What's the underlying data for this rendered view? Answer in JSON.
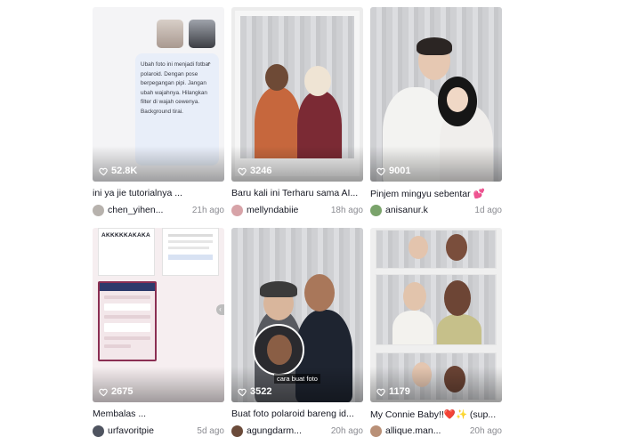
{
  "cards": [
    {
      "likes": "52.8K",
      "title": "ini ya jie tutorialnya ...",
      "user": "chen_yihen...",
      "time": "21h ago",
      "bubble_text": "Ubah foto ini menjadi fotbar polaroid. Dengan pose berpegangan pipi. Jangan ubah wajahnya. Hilangkan filter di wajah cewenya. Background tirai.",
      "icon": "chevron-up-icon"
    },
    {
      "likes": "3246",
      "title": "Baru kali ini Terharu sama AI...",
      "user": "mellyndabiie",
      "time": "18h ago"
    },
    {
      "likes": "9001",
      "title": "Pinjem mingyu sebentar 💕",
      "user": "anisanur.k",
      "time": "1d ago"
    },
    {
      "likes": "2675",
      "title": "Membalas ...",
      "user": "urfavoritpie",
      "time": "5d ago",
      "note_heading": "AKKKKKAKAKA"
    },
    {
      "likes": "3522",
      "title": "Buat foto polaroid bareng id...",
      "user": "agungdarm...",
      "time": "20h ago",
      "overlay_text": "cara buat foto"
    },
    {
      "likes": "1179",
      "title": "My Connie Baby!!❤️✨ (sup...",
      "user": "allique.man...",
      "time": "20h ago"
    }
  ],
  "colors": {
    "text": "#161823",
    "muted": "#8a8b91",
    "bubble": "#e8eef9"
  }
}
